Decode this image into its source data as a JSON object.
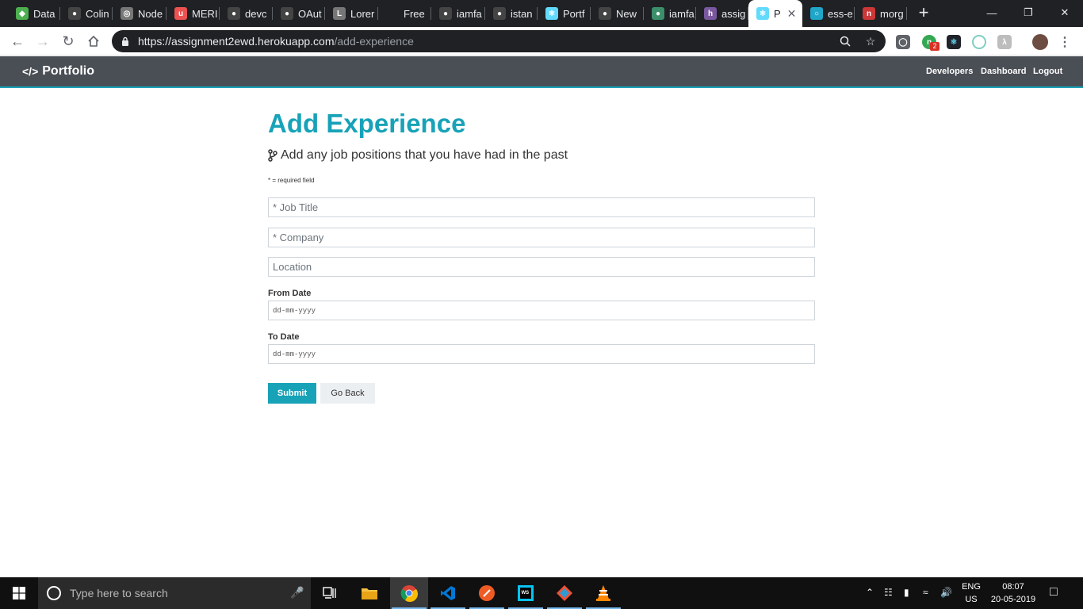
{
  "browser": {
    "tabs": [
      {
        "label": "Data",
        "icon": "leaf-icon",
        "color": "#4caf50"
      },
      {
        "label": "Colin",
        "icon": "github-icon",
        "color": "#444"
      },
      {
        "label": "Node",
        "icon": "globe-icon",
        "color": "#777"
      },
      {
        "label": "MERI",
        "icon": "udemy-icon",
        "color": "#ec5252"
      },
      {
        "label": "devc",
        "icon": "github-icon",
        "color": "#444"
      },
      {
        "label": "OAut",
        "icon": "github-icon",
        "color": "#444"
      },
      {
        "label": "Lorer",
        "icon": "lorem-icon",
        "color": "#777"
      },
      {
        "label": "Free",
        "icon": "",
        "color": "#202124"
      },
      {
        "label": "iamfa",
        "icon": "github-icon",
        "color": "#444"
      },
      {
        "label": "istan",
        "icon": "github-icon",
        "color": "#444"
      },
      {
        "label": "Portf",
        "icon": "react-icon",
        "color": "#61dafb"
      },
      {
        "label": "New",
        "icon": "github-icon",
        "color": "#444"
      },
      {
        "label": "iamfa",
        "icon": "github-icon",
        "color": "#3c8f6b"
      },
      {
        "label": "assig",
        "icon": "heroku-icon",
        "color": "#79589f"
      },
      {
        "label": "P",
        "icon": "react-icon",
        "color": "#61dafb",
        "active": true
      },
      {
        "label": "ess-e",
        "icon": "circle-icon",
        "color": "#1fa6c9"
      },
      {
        "label": "morg",
        "icon": "npm-icon",
        "color": "#cb3837"
      }
    ],
    "new_tab": "+",
    "url_host": "https://assignment2ewd.herokuapp.com",
    "url_path": "/add-experience",
    "ext_badge": "2"
  },
  "navbar": {
    "brand": "Portfolio",
    "links": [
      "Developers",
      "Dashboard",
      "Logout"
    ]
  },
  "form": {
    "title": "Add Experience",
    "lead": "Add any job positions that you have had in the past",
    "required_note": "* = required field",
    "job_title_placeholder": "* Job Title",
    "company_placeholder": "* Company",
    "location_placeholder": "Location",
    "from_label": "From Date",
    "from_value": "dd-mm-yyyy",
    "to_label": "To Date",
    "to_value": "dd-mm-yyyy",
    "submit_label": "Submit",
    "back_label": "Go Back"
  },
  "taskbar": {
    "search_placeholder": "Type here to search",
    "lang_line1": "ENG",
    "lang_line2": "US",
    "time": "08:07",
    "date": "20-05-2019"
  },
  "colors": {
    "accent": "#17a2b8",
    "navbar": "#4a4e55"
  }
}
